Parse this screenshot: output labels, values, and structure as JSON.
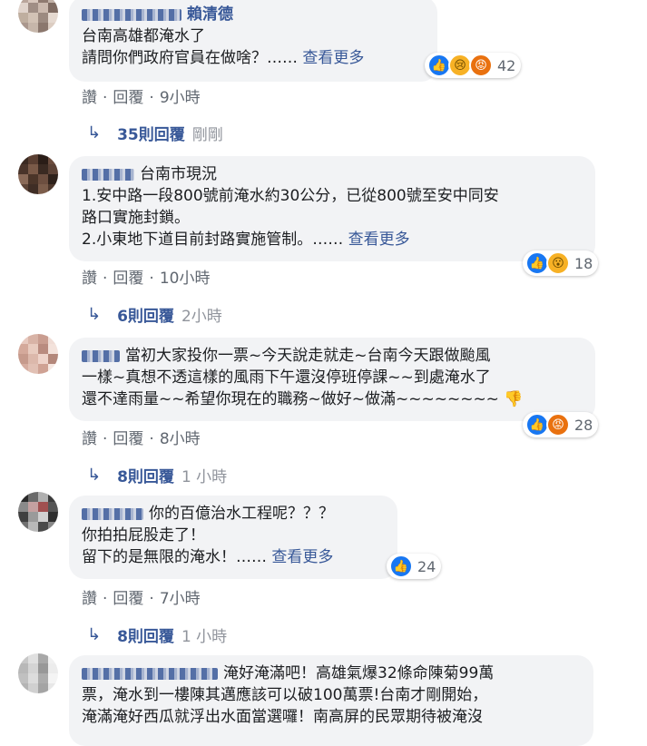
{
  "comments": [
    {
      "author": "賴清德",
      "lines": [
        "台南高雄都淹水了",
        "請問你們政府官員在做啥？……"
      ],
      "see_more": "查看更多",
      "reaction_count": "42",
      "reactions": [
        "like-icon",
        "sad-icon",
        "angry-icon"
      ],
      "actions": {
        "like": "讚",
        "reply": "回覆",
        "time": "9小時"
      },
      "replies": {
        "count": "35則回覆",
        "time": "剛剛"
      },
      "avatar_colors": [
        "#b9a59b",
        "#d8c7bd",
        "#8f7a70",
        "#c2b2a8",
        "#e0d3cb",
        "#a08e85",
        "#cbb9ae",
        "#7f6b62",
        "#bfae9f",
        "#d2c2b5",
        "#9c8a80",
        "#e5d9d0",
        "#aa978d",
        "#c6b6aa",
        "#8b776d",
        "#dccdc2"
      ]
    },
    {
      "author": "台南市現況",
      "lines": [
        "1.安中路一段800號前淹水約30公分，已從800號至安中同安",
        "路口實施封鎖。",
        "2.小東地下道目前封路實施管制。……"
      ],
      "see_more": "查看更多",
      "reaction_count": "18",
      "reactions": [
        "like-icon",
        "wow-icon"
      ],
      "actions": {
        "like": "讚",
        "reply": "回覆",
        "time": "10小時"
      },
      "replies": {
        "count": "6則回覆",
        "time": "2小時"
      },
      "avatar_colors": [
        "#3b2a22",
        "#5a3f32",
        "#2a1d17",
        "#6b4c3d",
        "#4a342a",
        "#7a5a48",
        "#3a2a22",
        "#5c4236",
        "#8a6a58",
        "#4b3529",
        "#6d4f40",
        "#2e211b",
        "#5e4538",
        "#3f2d25",
        "#7c5d4b",
        "#4d372c"
      ]
    },
    {
      "author": "",
      "lines": [
        "當初大家投你一票~今天說走就走~台南今天跟做颱風",
        "一樣~真想不透這樣的風雨下午還沒停班停課~~到處淹水了",
        "還不達雨量~~希望你現在的職務~做好~做滿~~~~~~~~"
      ],
      "see_more": "",
      "reaction_count": "28",
      "reactions": [
        "like-icon",
        "angry-icon"
      ],
      "actions": {
        "like": "讚",
        "reply": "回覆",
        "time": "8小時"
      },
      "replies": {
        "count": "8則回覆",
        "time": "1 小時"
      },
      "avatar_colors": [
        "#e7c9bf",
        "#d8b3a6",
        "#c99d90",
        "#f0ddd6",
        "#d4a99b",
        "#e8cbbf",
        "#b98b7f",
        "#f3e2db",
        "#c69a8c",
        "#dcb8ab",
        "#eed3ca",
        "#b3877a",
        "#d6ada0",
        "#e1c0b4",
        "#cfa294",
        "#f6e8e2"
      ]
    },
    {
      "author": "你的百億治水工程呢？？？",
      "lines": [
        "你拍拍屁股走了！",
        "留下的是無限的淹水！……"
      ],
      "see_more": "查看更多",
      "reaction_count": "24",
      "reactions": [
        "like-icon"
      ],
      "actions": {
        "like": "讚",
        "reply": "回覆",
        "time": "7小時"
      },
      "replies": {
        "count": "8則回覆",
        "time": "1 小時"
      },
      "avatar_colors": [
        "#2a2a2a",
        "#6a6a6a",
        "#b0b0b0",
        "#3c3c3c",
        "#8a8a8a",
        "#c4a0a0",
        "#a05050",
        "#555555",
        "#404040",
        "#9a9a9a",
        "#d0d0d0",
        "#2f2f2f",
        "#707070",
        "#b8b8b8",
        "#4a4a4a",
        "#888888"
      ]
    },
    {
      "author": "淹好淹滿吧！高雄氣爆32條命陳菊99萬",
      "lines": [
        "票，淹水到一樓陳其邁應該可以破100萬票!台南才剛開始，",
        "淹滿淹好西瓜就浮出水面當選囉！南高屏的民眾期待被淹沒"
      ],
      "see_more": "",
      "reaction_count": "",
      "reactions": [],
      "actions": {
        "like": "",
        "reply": "",
        "time": ""
      },
      "replies": {
        "count": "",
        "time": ""
      },
      "avatar_colors": [
        "#c8c8c8",
        "#e0e0e0",
        "#a8a8a8",
        "#f0f0f0",
        "#b8b8b8",
        "#d4d4d4",
        "#989898",
        "#ececec",
        "#c0c0c0",
        "#dcdcdc",
        "#acacac",
        "#f4f4f4",
        "#b4b4b4",
        "#d0d0d0",
        "#a4a4a4",
        "#e8e8e8"
      ]
    }
  ],
  "action_separator": "·"
}
